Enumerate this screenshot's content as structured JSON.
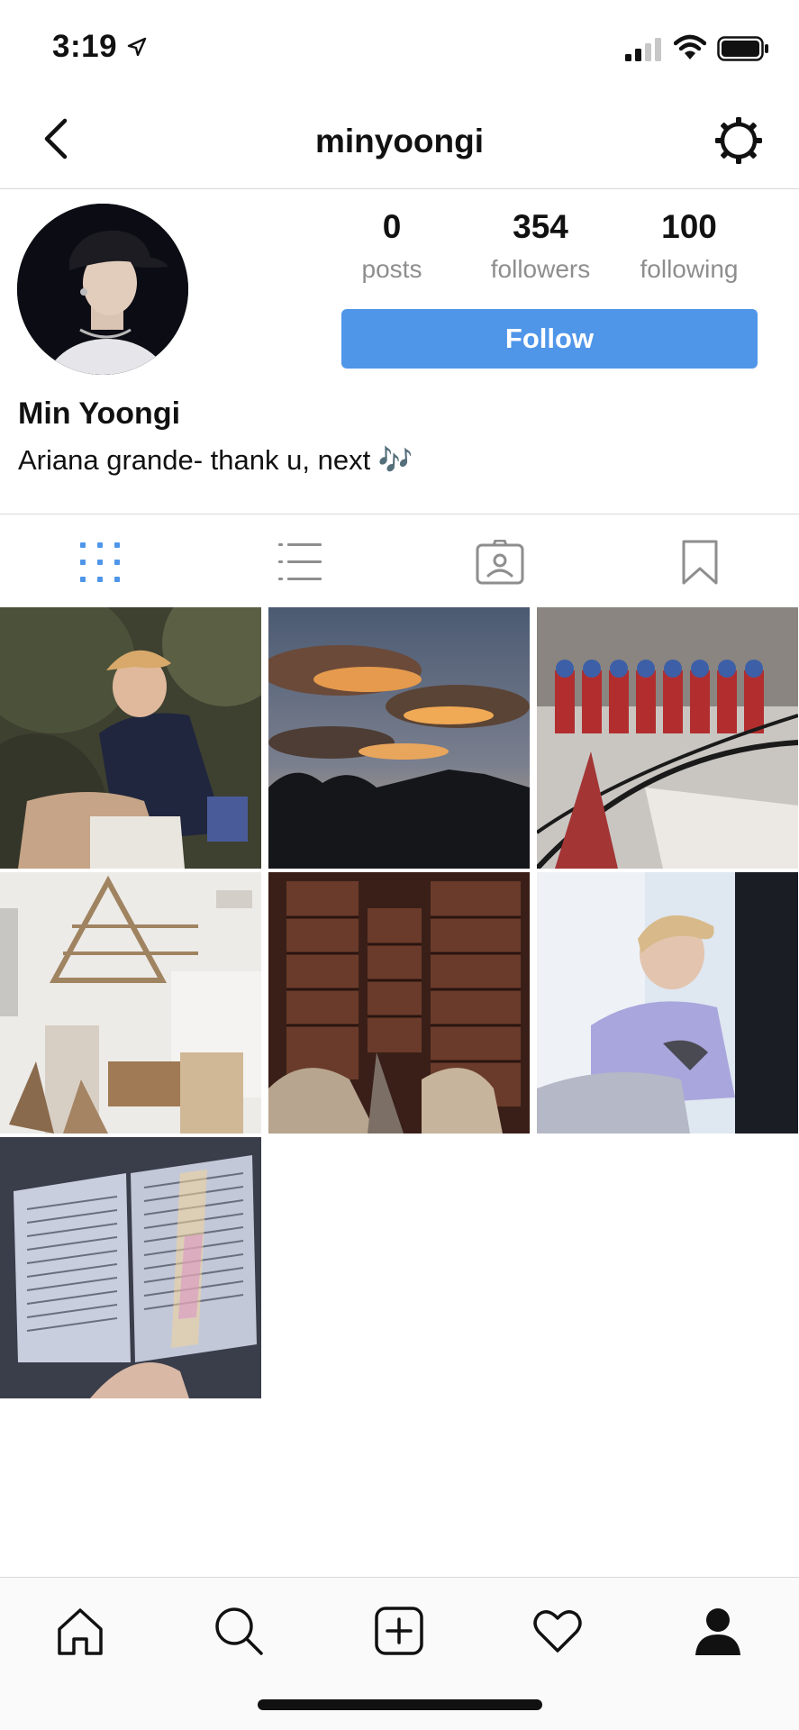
{
  "status_bar": {
    "time": "3:19",
    "icons": [
      "location-arrow-icon",
      "cellular-signal-icon",
      "wifi-icon",
      "battery-icon"
    ]
  },
  "nav": {
    "title": "minyoongi",
    "back_icon": "chevron-left-icon",
    "settings_icon": "gear-icon"
  },
  "profile": {
    "stats": [
      {
        "value": "0",
        "label": "posts"
      },
      {
        "value": "354",
        "label": "followers"
      },
      {
        "value": "100",
        "label": "following"
      }
    ],
    "follow_label": "Follow",
    "name": "Min Yoongi",
    "bio": "Ariana grande- thank u, next 🎶"
  },
  "tabs": [
    {
      "name": "grid",
      "icon": "grid-icon",
      "active": true
    },
    {
      "name": "list",
      "icon": "list-icon",
      "active": false
    },
    {
      "name": "tagged",
      "icon": "tagged-person-icon",
      "active": false
    },
    {
      "name": "saved",
      "icon": "bookmark-icon",
      "active": false
    }
  ],
  "posts": [
    {
      "description": "person sitting outdoors"
    },
    {
      "description": "sunset clouds"
    },
    {
      "description": "spiral staircase with mirrors"
    },
    {
      "description": "cafe interior"
    },
    {
      "description": "bookstore shelves"
    },
    {
      "description": "person by window"
    },
    {
      "description": "open book with rainbow light"
    }
  ],
  "bottom_nav": [
    {
      "name": "home",
      "icon": "home-icon"
    },
    {
      "name": "search",
      "icon": "search-icon"
    },
    {
      "name": "add",
      "icon": "add-post-icon"
    },
    {
      "name": "activity",
      "icon": "heart-icon"
    },
    {
      "name": "profile",
      "icon": "profile-icon"
    }
  ],
  "colors": {
    "accent": "#4f96e9",
    "muted": "#8e8e8e",
    "divider": "#d8d8d8"
  }
}
